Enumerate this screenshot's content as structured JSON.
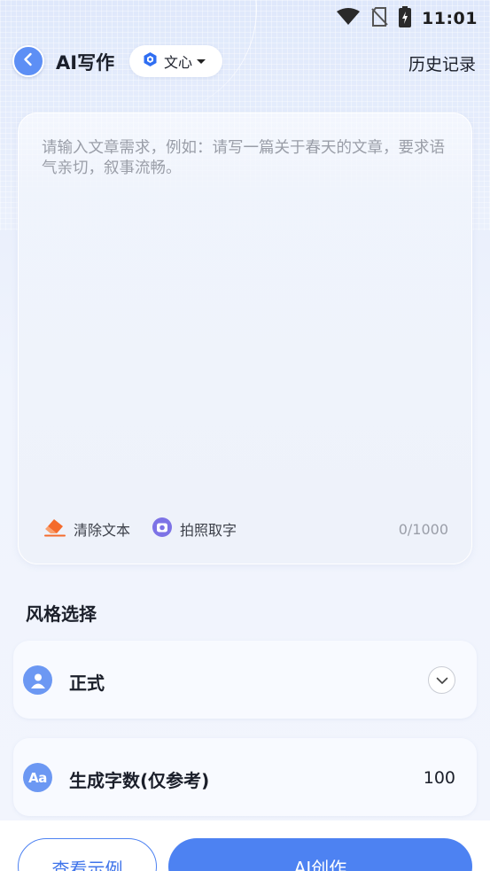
{
  "status_bar": {
    "time": "11:01",
    "icons": [
      "wifi-icon",
      "no-sim-icon",
      "battery-charging-icon"
    ]
  },
  "header": {
    "title": "AI写作",
    "model_selector": {
      "label": "文心",
      "icon": "wenxin-logo-icon"
    },
    "history_label": "历史记录"
  },
  "input": {
    "value": "",
    "placeholder": "请输入文章需求，例如：请写一篇关于春天的文章，要求语气亲切，叙事流畅。",
    "clear_label": "清除文本",
    "photo_label": "拍照取字",
    "char_count": "0/1000"
  },
  "style_section": {
    "title": "风格选择",
    "style": {
      "label": "正式",
      "icon": "person-icon"
    },
    "word_count": {
      "label": "生成字数(仅参考)",
      "value": "100",
      "icon": "font-aa-icon"
    }
  },
  "actions": {
    "example_label": "查看示例",
    "create_label": "AI创作"
  },
  "colors": {
    "accent": "#4d82f2",
    "icon_blue": "#6c98f3",
    "eraser_orange": "#f46b2c",
    "camera_purple": "#7d73e6"
  }
}
